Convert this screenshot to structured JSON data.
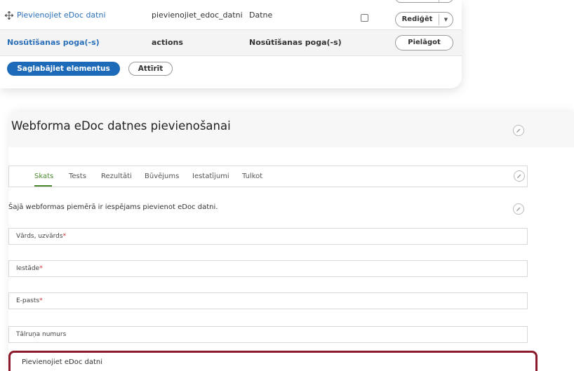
{
  "elements_table": {
    "rows": [
      {
        "title": "Pievienojiet eDoc datni",
        "key": "pievienojiet_edoc_datni",
        "type": "Datne",
        "action_label": "Rediģēt"
      },
      {
        "title": "Nosūtīšanas poga(-s)",
        "key": "actions",
        "type": "Nosūtīšanas poga(-s)",
        "action_label": "Pielāgot"
      }
    ],
    "save_label": "Saglabājiet elementus",
    "reset_label": "Attīrīt"
  },
  "webform": {
    "title": "Webforma eDoc datnes pievienošanai",
    "tabs": [
      {
        "label": "Skats"
      },
      {
        "label": "Tests"
      },
      {
        "label": "Rezultāti"
      },
      {
        "label": "Būvējums"
      },
      {
        "label": "Iestatījumi"
      },
      {
        "label": "Tulkot"
      }
    ],
    "description": "Šajā webformas piemērā ir iespējams pievienot eDoc datni.",
    "fields": [
      {
        "label": "Vārds, uzvārds",
        "required_mark": "*"
      },
      {
        "label": "Iestāde",
        "required_mark": "*"
      },
      {
        "label": "E-pasts",
        "required_mark": "*"
      },
      {
        "label": "Tālruņa numurs",
        "required_mark": ""
      }
    ],
    "highlighted_field": {
      "label": "Pievienojiet eDoc datni"
    }
  },
  "colors": {
    "link": "#2a6fb8",
    "primary_button": "#1d6bb8",
    "active_tab": "#4d8a2f",
    "required": "#d32d2d",
    "highlight_border": "#8b1a2a"
  },
  "icons": {
    "drag_handle": "drag-handle-icon",
    "edit": "pencil-icon",
    "dropdown": "chevron-down-icon"
  }
}
